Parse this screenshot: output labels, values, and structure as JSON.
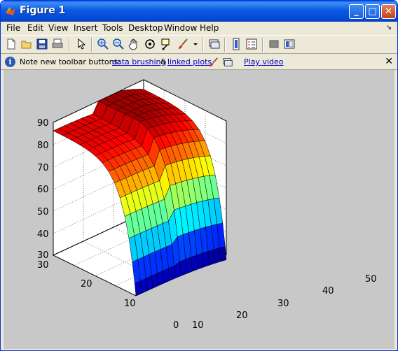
{
  "window": {
    "title": "Figure 1",
    "controls": [
      "_",
      "□",
      "✕"
    ]
  },
  "menu": [
    "File",
    "Edit",
    "View",
    "Insert",
    "Tools",
    "Desktop",
    "Window",
    "Help"
  ],
  "toolbar": {
    "icons": [
      "new-figure-icon",
      "open-file-icon",
      "save-icon",
      "print-icon",
      "pointer-icon",
      "zoom-in-icon",
      "zoom-out-icon",
      "pan-icon",
      "rotate-3d-icon",
      "data-cursor-icon",
      "brush-icon",
      "brush-dropdown-icon",
      "link-plot-icon",
      "colorbar-icon",
      "legend-icon",
      "hide-plot-tools-icon",
      "show-plot-tools-icon"
    ]
  },
  "infobar": {
    "text": "Note new toolbar buttons:",
    "link1": "data brushing",
    "amp": "&",
    "link2": "linked plots",
    "video": "Play video",
    "close": "✕"
  },
  "chart_data": {
    "type": "surface",
    "zlim": [
      30,
      90
    ],
    "xlim": [
      10,
      50
    ],
    "ylim": [
      0,
      30
    ],
    "zticks": [
      "90",
      "80",
      "70",
      "60",
      "50",
      "40",
      "30"
    ],
    "xticks": [
      "10",
      "20",
      "30",
      "40",
      "50"
    ],
    "yticks": [
      "30",
      "20",
      "10",
      "0"
    ],
    "grid": true,
    "colormap": "jet"
  }
}
